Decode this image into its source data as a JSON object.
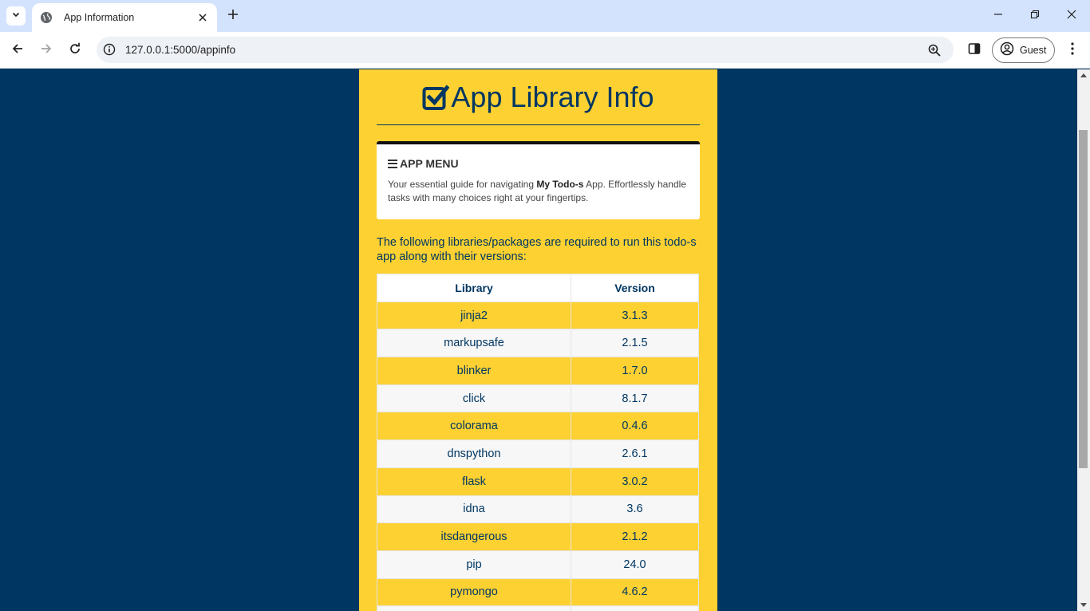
{
  "browser": {
    "tab_title": "App Information",
    "url": "127.0.0.1:5000/appinfo",
    "profile_label": "Guest"
  },
  "page": {
    "title": "App Library Info",
    "menu": {
      "heading": "APP MENU",
      "desc_prefix": "Your essential guide for navigating ",
      "desc_bold": "My Todo-s",
      "desc_suffix": " App. Effortlessly handle tasks with many choices right at your fingertips."
    },
    "intro": "The following libraries/packages are required to run this todo-s app along with their versions:",
    "table": {
      "headers": [
        "Library",
        "Version"
      ],
      "rows": [
        {
          "library": "jinja2",
          "version": "3.1.3"
        },
        {
          "library": "markupsafe",
          "version": "2.1.5"
        },
        {
          "library": "blinker",
          "version": "1.7.0"
        },
        {
          "library": "click",
          "version": "8.1.7"
        },
        {
          "library": "colorama",
          "version": "0.4.6"
        },
        {
          "library": "dnspython",
          "version": "2.6.1"
        },
        {
          "library": "flask",
          "version": "3.0.2"
        },
        {
          "library": "idna",
          "version": "3.6"
        },
        {
          "library": "itsdangerous",
          "version": "2.1.2"
        },
        {
          "library": "pip",
          "version": "24.0"
        },
        {
          "library": "pymongo",
          "version": "4.6.2"
        }
      ]
    }
  },
  "colors": {
    "background": "#003662",
    "card": "#fcd131",
    "text": "#003662"
  }
}
